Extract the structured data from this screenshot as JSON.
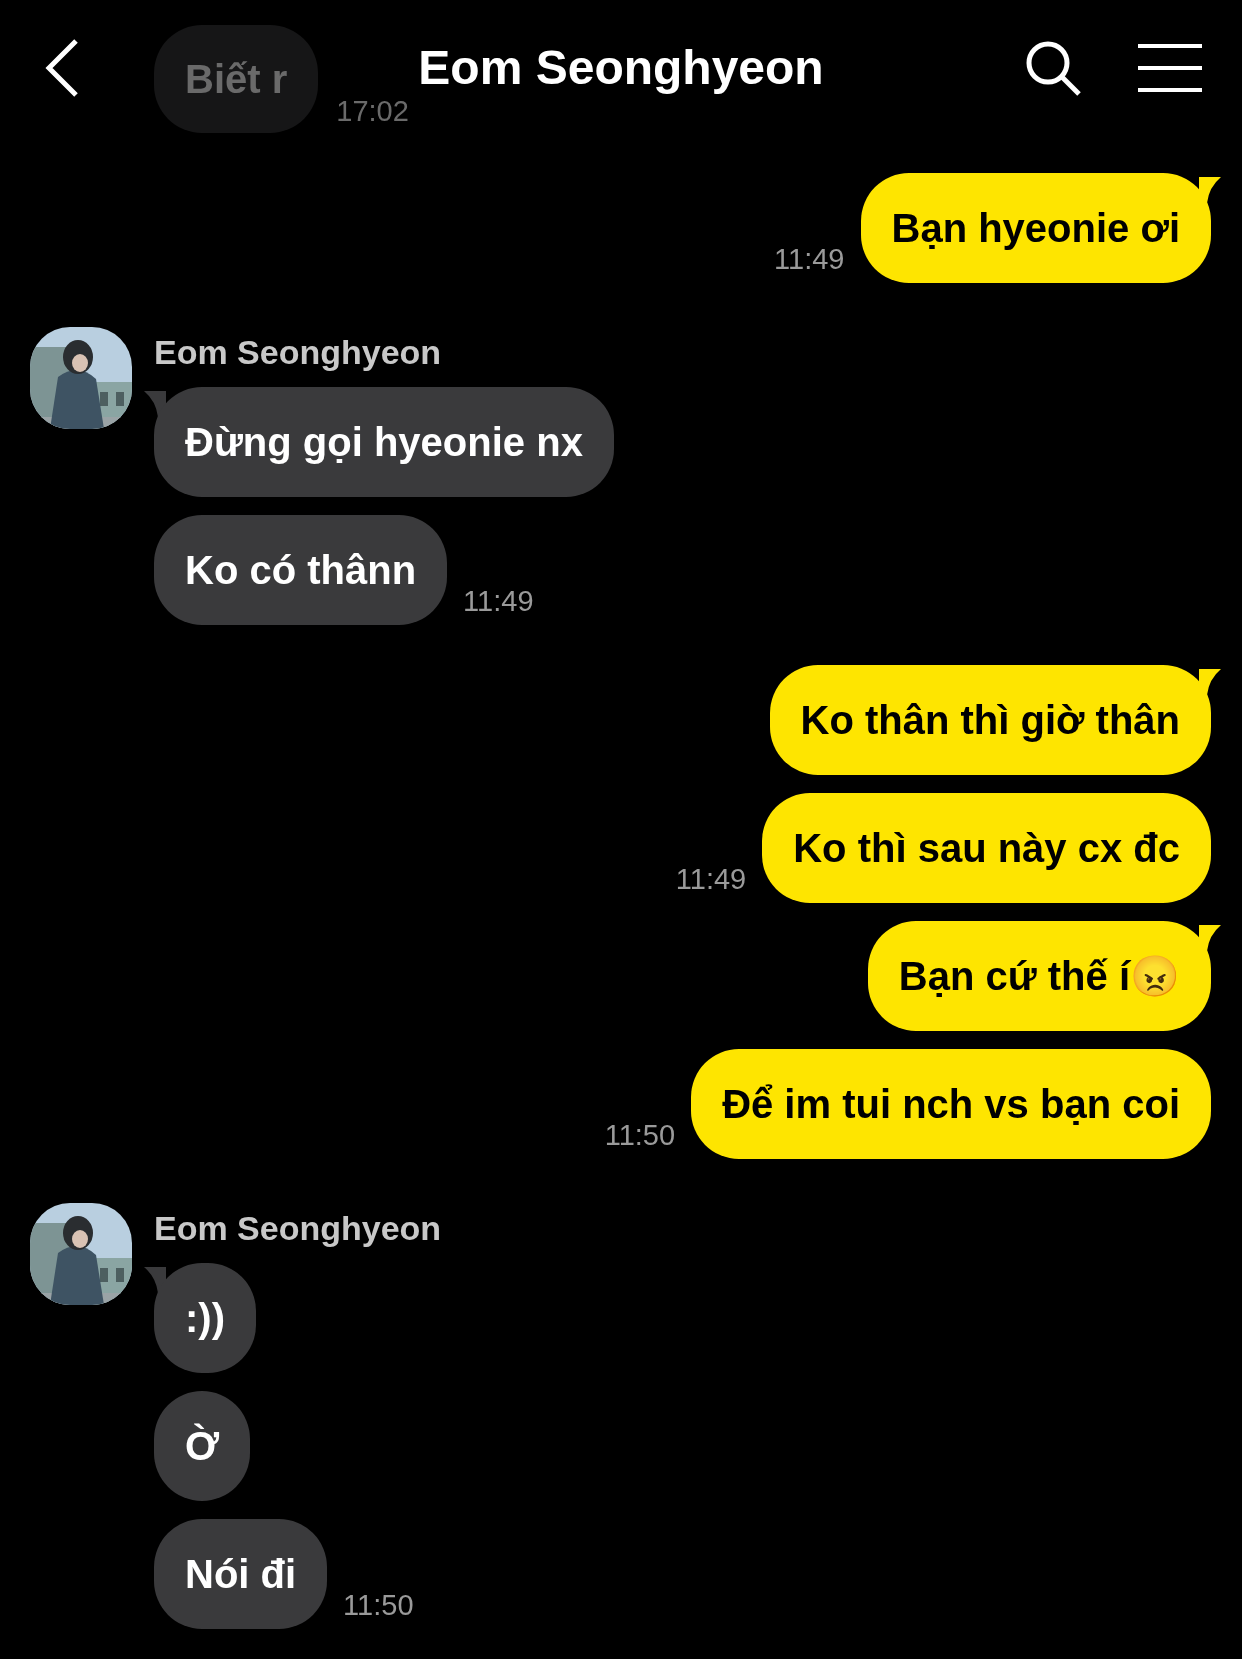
{
  "header": {
    "title": "Eom Seonghyeon"
  },
  "faded_message": {
    "text": "Biết r",
    "time": "17:02"
  },
  "groups": [
    {
      "kind": "sent",
      "bubbles": [
        {
          "text": "Bạn hyeonie ơi",
          "tail": true,
          "time": "11:49"
        }
      ]
    },
    {
      "kind": "received",
      "sender": "Eom Seonghyeon",
      "avatar": {
        "kind": "picture"
      },
      "bubbles": [
        {
          "text": "Đừng gọi hyeonie nx",
          "tail": true
        },
        {
          "text": "Ko có thânn",
          "tail": false,
          "time": "11:49"
        }
      ]
    },
    {
      "kind": "sent",
      "bubbles": [
        {
          "text": "Ko thân thì giờ thân",
          "tail": true
        },
        {
          "text": "Ko thì sau này cx đc",
          "tail": false,
          "time": "11:49"
        },
        {
          "text": "Bạn cứ thế í😠",
          "tail": true
        },
        {
          "text": "Để im tui nch vs bạn coi",
          "tail": false,
          "time": "11:50"
        }
      ]
    },
    {
      "kind": "received",
      "sender": "Eom Seonghyeon",
      "avatar": {
        "kind": "picture"
      },
      "bubbles": [
        {
          "text": ":))",
          "tail": true
        },
        {
          "text": "Ờ",
          "tail": false
        },
        {
          "text": "Nói đi",
          "tail": false,
          "time": "11:50"
        }
      ]
    }
  ]
}
